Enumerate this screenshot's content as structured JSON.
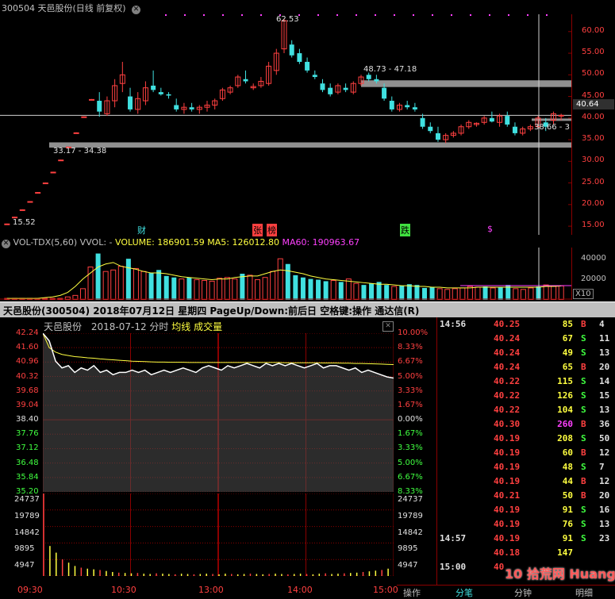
{
  "daily": {
    "title": "300504 天邑股份(日线 前复权)",
    "price_ticks": [
      "60.00",
      "55.00",
      "50.00",
      "45.00",
      "40.00",
      "35.00",
      "30.00",
      "25.00",
      "20.00",
      "15.00"
    ],
    "current_price_label": "40.64",
    "high_label": "62.53",
    "low_label": "15.52",
    "range_label_1": "48.73 - 47.18",
    "range_label_2": "33.17 - 34.38",
    "range_label_3": "38.66 - 3",
    "markers": {
      "cai": "财",
      "zhang": "张",
      "bang": "榜",
      "die": "跌",
      "dollar": "$"
    },
    "chart_data": {
      "type": "candlestick",
      "ylim": [
        13,
        64
      ],
      "candles": [
        {
          "o": 15.5,
          "h": 15.6,
          "l": 15.5,
          "c": 15.52
        },
        {
          "o": 17,
          "h": 17.2,
          "l": 17,
          "c": 17.1
        },
        {
          "o": 18.8,
          "h": 18.9,
          "l": 18.8,
          "c": 18.8
        },
        {
          "o": 20.7,
          "h": 20.8,
          "l": 20.7,
          "c": 20.7
        },
        {
          "o": 22.8,
          "h": 22.9,
          "l": 22.8,
          "c": 22.8
        },
        {
          "o": 25,
          "h": 25.1,
          "l": 25,
          "c": 25
        },
        {
          "o": 27.5,
          "h": 27.6,
          "l": 27.5,
          "c": 27.5
        },
        {
          "o": 30.3,
          "h": 30.4,
          "l": 30.3,
          "c": 30.3
        },
        {
          "o": 33.3,
          "h": 33.4,
          "l": 33.2,
          "c": 33.3
        },
        {
          "o": 36.6,
          "h": 36.7,
          "l": 36.6,
          "c": 36.6
        },
        {
          "o": 40.3,
          "h": 40.4,
          "l": 40.3,
          "c": 40.3
        },
        {
          "o": 44.3,
          "h": 44.4,
          "l": 44.3,
          "c": 44.3
        },
        {
          "o": 44,
          "h": 46,
          "l": 40.3,
          "c": 41.5
        },
        {
          "o": 41,
          "h": 45,
          "l": 40.5,
          "c": 44
        },
        {
          "o": 44,
          "h": 49,
          "l": 42.5,
          "c": 47.5
        },
        {
          "o": 48,
          "h": 53,
          "l": 46,
          "c": 50
        },
        {
          "o": 45,
          "h": 47,
          "l": 41.5,
          "c": 42
        },
        {
          "o": 42,
          "h": 46,
          "l": 41,
          "c": 44.5
        },
        {
          "o": 44,
          "h": 48.5,
          "l": 43,
          "c": 47
        },
        {
          "o": 47.5,
          "h": 51,
          "l": 46,
          "c": 46.5
        },
        {
          "o": 46,
          "h": 47,
          "l": 45.2,
          "c": 45.5
        },
        {
          "o": 45.5,
          "h": 46,
          "l": 44.5,
          "c": 45.2
        },
        {
          "o": 43,
          "h": 44.5,
          "l": 41.5,
          "c": 42
        },
        {
          "o": 42,
          "h": 43.5,
          "l": 41,
          "c": 42.5
        },
        {
          "o": 42.5,
          "h": 43.5,
          "l": 41.5,
          "c": 42
        },
        {
          "o": 42,
          "h": 43,
          "l": 41,
          "c": 42.5
        },
        {
          "o": 42.5,
          "h": 44,
          "l": 41.5,
          "c": 43
        },
        {
          "o": 43,
          "h": 44.5,
          "l": 42,
          "c": 44
        },
        {
          "o": 44.5,
          "h": 47,
          "l": 44,
          "c": 46.5
        },
        {
          "o": 46,
          "h": 47.5,
          "l": 45.5,
          "c": 47
        },
        {
          "o": 47.5,
          "h": 50,
          "l": 47,
          "c": 49.5
        },
        {
          "o": 49,
          "h": 51,
          "l": 48,
          "c": 48.5
        },
        {
          "o": 47,
          "h": 48,
          "l": 46.5,
          "c": 47.3
        },
        {
          "o": 47.5,
          "h": 49.5,
          "l": 47,
          "c": 48.5
        },
        {
          "o": 48,
          "h": 53,
          "l": 47.5,
          "c": 52
        },
        {
          "o": 51,
          "h": 56,
          "l": 50,
          "c": 55
        },
        {
          "o": 56,
          "h": 63,
          "l": 55,
          "c": 62.53
        },
        {
          "o": 57,
          "h": 58,
          "l": 54,
          "c": 54.5
        },
        {
          "o": 55,
          "h": 56,
          "l": 52.5,
          "c": 53
        },
        {
          "o": 53,
          "h": 54,
          "l": 50.5,
          "c": 51
        },
        {
          "o": 50,
          "h": 51,
          "l": 49,
          "c": 49.5
        },
        {
          "o": 48,
          "h": 49,
          "l": 46,
          "c": 46.5
        },
        {
          "o": 47,
          "h": 48,
          "l": 45,
          "c": 45.5
        },
        {
          "o": 46,
          "h": 48,
          "l": 45.5,
          "c": 47.5
        },
        {
          "o": 47,
          "h": 48,
          "l": 46,
          "c": 46.5
        },
        {
          "o": 46,
          "h": 48.5,
          "l": 45.5,
          "c": 48
        },
        {
          "o": 48,
          "h": 50,
          "l": 47.5,
          "c": 49.5
        },
        {
          "o": 50,
          "h": 50.5,
          "l": 48.5,
          "c": 49
        },
        {
          "o": 49,
          "h": 50,
          "l": 48,
          "c": 48.5
        },
        {
          "o": 47,
          "h": 48,
          "l": 44,
          "c": 44.5
        },
        {
          "o": 44,
          "h": 45,
          "l": 41.5,
          "c": 42
        },
        {
          "o": 42,
          "h": 43.5,
          "l": 41.5,
          "c": 43
        },
        {
          "o": 43,
          "h": 44,
          "l": 42,
          "c": 42.5
        },
        {
          "o": 42.5,
          "h": 43.5,
          "l": 41.5,
          "c": 42
        },
        {
          "o": 40,
          "h": 41,
          "l": 37.5,
          "c": 38
        },
        {
          "o": 38,
          "h": 39,
          "l": 36.5,
          "c": 37
        },
        {
          "o": 36.5,
          "h": 38,
          "l": 34.5,
          "c": 35
        },
        {
          "o": 35,
          "h": 36.5,
          "l": 34.2,
          "c": 36
        },
        {
          "o": 36,
          "h": 37,
          "l": 35.5,
          "c": 36.5
        },
        {
          "o": 36.5,
          "h": 38.5,
          "l": 36,
          "c": 38
        },
        {
          "o": 38,
          "h": 39.5,
          "l": 37.5,
          "c": 39
        },
        {
          "o": 38.5,
          "h": 39,
          "l": 38,
          "c": 38.8
        },
        {
          "o": 39,
          "h": 40.5,
          "l": 38.5,
          "c": 40
        },
        {
          "o": 40,
          "h": 41.5,
          "l": 39,
          "c": 39.2
        },
        {
          "o": 39,
          "h": 41,
          "l": 38,
          "c": 40.5
        },
        {
          "o": 40.5,
          "h": 41.5,
          "l": 38,
          "c": 38.5
        },
        {
          "o": 38,
          "h": 39,
          "l": 36,
          "c": 36.5
        },
        {
          "o": 36.5,
          "h": 38,
          "l": 36,
          "c": 37.5
        },
        {
          "o": 37.5,
          "h": 38.5,
          "l": 37,
          "c": 38
        },
        {
          "o": 38,
          "h": 40.5,
          "l": 37.5,
          "c": 40
        },
        {
          "o": 39,
          "h": 40,
          "l": 37,
          "c": 38
        },
        {
          "o": 39.5,
          "h": 41.5,
          "l": 38.5,
          "c": 41
        },
        {
          "o": 40.5,
          "h": 41,
          "l": 39.5,
          "c": 40.64
        }
      ]
    }
  },
  "volume": {
    "title": "VOL-TDX(5,60) VVOL: -",
    "volume_label": "VOLUME: 186901.59",
    "ma5_label": "MA5: 126012.80",
    "ma60_label": "MA60: 190963.67",
    "ticks": [
      "40000",
      "20000"
    ],
    "unit": "X10",
    "chart_data": {
      "type": "bar",
      "values": [
        2,
        2,
        2,
        2,
        2,
        2,
        2,
        2,
        4,
        6,
        15,
        44,
        62,
        38,
        40,
        45,
        55,
        42,
        38,
        36,
        40,
        32,
        30,
        28,
        30,
        27,
        26,
        25,
        29,
        30,
        28,
        35,
        33,
        27,
        30,
        38,
        55,
        48,
        33,
        30,
        28,
        27,
        25,
        26,
        24,
        28,
        22,
        20,
        22,
        24,
        20,
        18,
        19,
        21,
        20,
        16,
        17,
        15,
        14,
        15,
        16,
        18,
        17,
        18,
        16,
        17,
        20,
        15,
        14,
        16,
        18,
        20,
        18,
        18.7
      ],
      "ma5": [
        2,
        2,
        2,
        2,
        2,
        3,
        4,
        6,
        10,
        18,
        28,
        36,
        44,
        48,
        50,
        45,
        43,
        41,
        38,
        36,
        36,
        35,
        33,
        31,
        30,
        29,
        28,
        27,
        28,
        28,
        30,
        31,
        32,
        32,
        35,
        38,
        40,
        39,
        37,
        35,
        32,
        30,
        28,
        27,
        26,
        25,
        24,
        23,
        22,
        21,
        21,
        20,
        19,
        19,
        18,
        18,
        17,
        17,
        16,
        16,
        16,
        16,
        17,
        17,
        17,
        17,
        17,
        17,
        17,
        17,
        17,
        18,
        18,
        18.5
      ],
      "ma60_level": 19.1,
      "ylim": [
        0,
        70
      ]
    }
  },
  "info_bar": {
    "text": "天邑股份(300504) 2018年07月12日 星期四 PageUp/Down:前后日 空格键:操作 通达信(R)"
  },
  "intraday": {
    "title": "天邑股份",
    "date": "2018-07-12 分时",
    "avg_label": "均线",
    "vol_label": "成交量",
    "price_ticks": [
      "42.24",
      "41.60",
      "40.96",
      "40.32",
      "39.68",
      "39.04",
      "38.40",
      "37.76",
      "37.12",
      "36.48",
      "35.84",
      "35.20"
    ],
    "pct_ticks": [
      "10.00%",
      "8.33%",
      "6.67%",
      "5.00%",
      "3.33%",
      "1.67%",
      "0.00%",
      "1.67%",
      "3.33%",
      "5.00%",
      "6.67%",
      "8.33%"
    ],
    "vol_ticks": [
      "24737",
      "19789",
      "14842",
      "9895",
      "4947"
    ],
    "time_ticks": [
      "09:30",
      "10:30",
      "13:00",
      "14:00",
      "15:00"
    ],
    "chart_data": {
      "type": "line",
      "ylim": [
        35.2,
        42.24
      ],
      "price": [
        42.24,
        41.9,
        41.0,
        40.7,
        40.8,
        40.5,
        40.7,
        40.6,
        40.8,
        40.5,
        40.6,
        40.4,
        40.5,
        40.5,
        40.6,
        40.5,
        40.6,
        40.4,
        40.5,
        40.6,
        40.5,
        40.6,
        40.7,
        40.6,
        40.5,
        40.7,
        40.8,
        40.7,
        40.6,
        40.8,
        40.7,
        40.8,
        40.9,
        40.8,
        40.7,
        40.9,
        40.8,
        40.9,
        40.8,
        40.9,
        40.8,
        40.7,
        40.8,
        40.9,
        40.7,
        40.8,
        40.8,
        40.7,
        40.6,
        40.7,
        40.5,
        40.6,
        40.5,
        40.4,
        40.3,
        40.25
      ],
      "avg": [
        42.24,
        41.6,
        41.4,
        41.3,
        41.25,
        41.2,
        41.18,
        41.15,
        41.13,
        41.1,
        41.08,
        41.06,
        41.04,
        41.02,
        41.0,
        40.99,
        40.98,
        40.97,
        40.96,
        40.96,
        40.95,
        40.95,
        40.95,
        40.94,
        40.94,
        40.94,
        40.94,
        40.94,
        40.94,
        40.94,
        40.94,
        40.94,
        40.94,
        40.94,
        40.94,
        40.94,
        40.94,
        40.94,
        40.93,
        40.93,
        40.93,
        40.93,
        40.93,
        40.93,
        40.92,
        40.92,
        40.92,
        40.91,
        40.91,
        40.9,
        40.9,
        40.89,
        40.88,
        40.87,
        40.86,
        40.85
      ],
      "volume": [
        24737,
        9000,
        7000,
        5000,
        4000,
        3000,
        2500,
        2200,
        2000,
        1800,
        1500,
        1200,
        1000,
        900,
        800,
        900,
        700,
        600,
        800,
        700,
        600,
        500,
        700,
        600,
        500,
        600,
        700,
        600,
        500,
        700,
        600,
        500,
        600,
        700,
        600,
        500,
        600,
        700,
        600,
        500,
        600,
        700,
        600,
        500,
        700,
        800,
        600,
        700,
        800,
        900,
        1000,
        1200,
        1400,
        1600,
        1800,
        2200
      ]
    }
  },
  "tape": {
    "rows": [
      {
        "time": "14:56",
        "price": "40.25",
        "vol": "85",
        "side": "B",
        "n": "4"
      },
      {
        "time": "",
        "price": "40.24",
        "vol": "67",
        "side": "S",
        "n": "11"
      },
      {
        "time": "",
        "price": "40.24",
        "vol": "49",
        "side": "S",
        "n": "13"
      },
      {
        "time": "",
        "price": "40.24",
        "vol": "65",
        "side": "B",
        "n": "20"
      },
      {
        "time": "",
        "price": "40.22",
        "vol": "115",
        "side": "S",
        "n": "14"
      },
      {
        "time": "",
        "price": "40.22",
        "vol": "126",
        "side": "S",
        "n": "15"
      },
      {
        "time": "",
        "price": "40.22",
        "vol": "104",
        "side": "S",
        "n": "13"
      },
      {
        "time": "",
        "price": "40.30",
        "vol": "260",
        "side": "B",
        "n": "36"
      },
      {
        "time": "",
        "price": "40.19",
        "vol": "208",
        "side": "S",
        "n": "50"
      },
      {
        "time": "",
        "price": "40.19",
        "vol": "60",
        "side": "B",
        "n": "12"
      },
      {
        "time": "",
        "price": "40.19",
        "vol": "48",
        "side": "S",
        "n": "7"
      },
      {
        "time": "",
        "price": "40.19",
        "vol": "44",
        "side": "B",
        "n": "12"
      },
      {
        "time": "",
        "price": "40.21",
        "vol": "50",
        "side": "B",
        "n": "20"
      },
      {
        "time": "",
        "price": "40.19",
        "vol": "91",
        "side": "S",
        "n": "16"
      },
      {
        "time": "",
        "price": "40.19",
        "vol": "76",
        "side": "S",
        "n": "13"
      },
      {
        "time": "14:57",
        "price": "40.19",
        "vol": "91",
        "side": "S",
        "n": "23"
      },
      {
        "time": "",
        "price": "40.18",
        "vol": "147",
        "side": "",
        "n": ""
      },
      {
        "time": "15:00",
        "price": "40",
        "vol": "",
        "side": "",
        "n": ""
      }
    ]
  },
  "tabs": {
    "ops": "操作",
    "ticks": "分笔",
    "minute": "分钟",
    "detail": "明细"
  },
  "watermark": "10 拾荒网 Huang.cn",
  "colors": {
    "up": "#ff4040",
    "down": "#40e0e0",
    "price_line": "#ffffff",
    "avg_line": "#ffff40",
    "grid": "#8b0000"
  }
}
